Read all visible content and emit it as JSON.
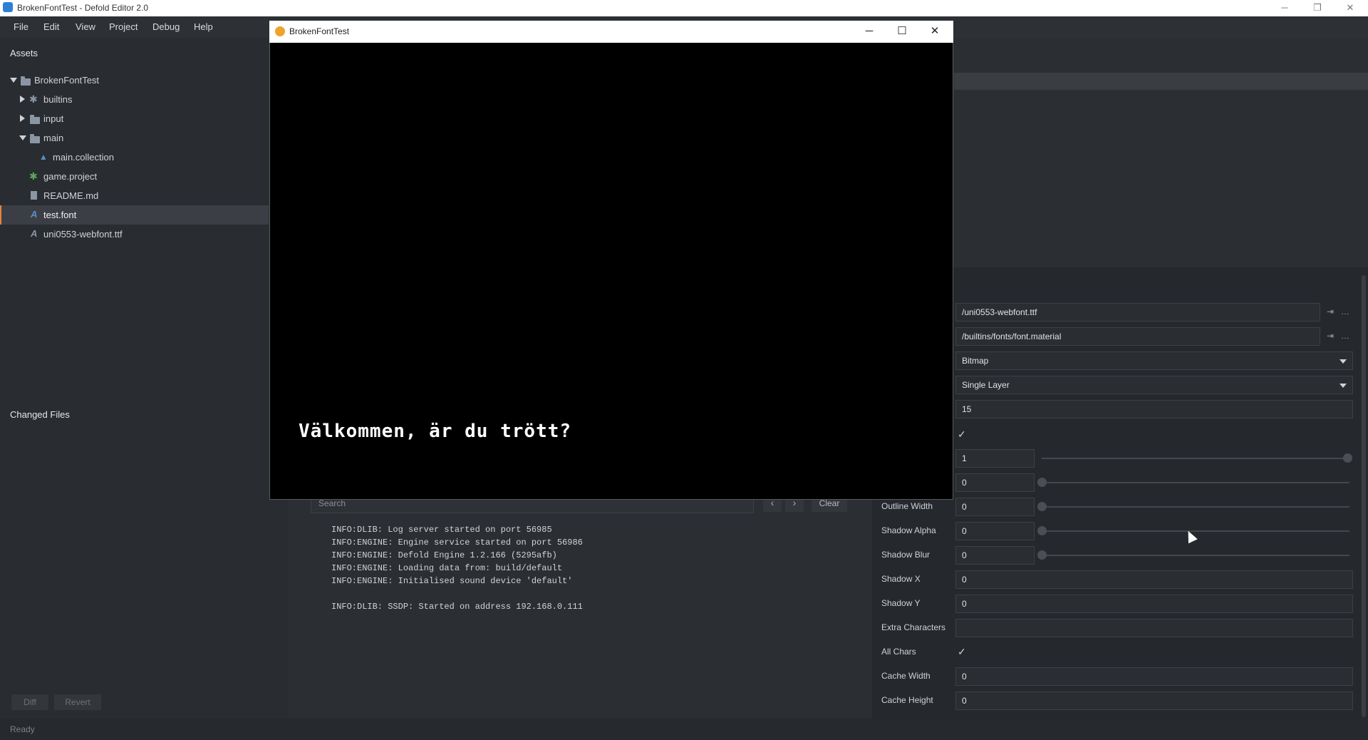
{
  "window": {
    "title": "BrokenFontTest - Defold Editor 2.0",
    "min": "─",
    "restore": "❐",
    "close": "✕"
  },
  "menubar": [
    "File",
    "Edit",
    "View",
    "Project",
    "Debug",
    "Help"
  ],
  "assets": {
    "header": "Assets",
    "tree": [
      {
        "label": "BrokenFontTest",
        "icon": "folder-icon"
      },
      {
        "label": "builtins",
        "icon": "gear-icon"
      },
      {
        "label": "input",
        "icon": "folder-icon"
      },
      {
        "label": "main",
        "icon": "folder-icon"
      },
      {
        "label": "main.collection",
        "icon": "collection-icon"
      },
      {
        "label": "game.project",
        "icon": "gear-icon"
      },
      {
        "label": "README.md",
        "icon": "file-icon"
      },
      {
        "label": "test.font",
        "icon": "font-icon"
      },
      {
        "label": "uni0553-webfont.ttf",
        "icon": "font-icon"
      }
    ]
  },
  "changed_files": {
    "header": "Changed Files",
    "diff": "Diff",
    "revert": "Revert"
  },
  "status": "Ready",
  "console": {
    "search_placeholder": "Search",
    "prev": "‹",
    "next": "›",
    "clear": "Clear",
    "lines": [
      "INFO:DLIB: Log server started on port 56985",
      "INFO:ENGINE: Engine service started on port 56986",
      "INFO:ENGINE: Defold Engine 1.2.166 (5295afb)",
      "INFO:ENGINE: Loading data from: build/default",
      "INFO:ENGINE: Initialised sound device 'default'",
      "",
      "INFO:DLIB: SSDP: Started on address 192.168.0.111"
    ]
  },
  "properties": {
    "font_path": "/uni0553-webfont.ttf",
    "material_path": "/builtins/fonts/font.material",
    "output_format": "Bitmap",
    "render_mode": "Single Layer",
    "size": "15",
    "alpha": "1",
    "outline_alpha": "0",
    "outline_width_label": "Outline Width",
    "outline_width": "0",
    "shadow_alpha_label": "Shadow Alpha",
    "shadow_alpha": "0",
    "shadow_blur_label": "Shadow Blur",
    "shadow_blur": "0",
    "shadow_x_label": "Shadow X",
    "shadow_x": "0",
    "shadow_y_label": "Shadow Y",
    "shadow_y": "0",
    "extra_characters_label": "Extra Characters",
    "extra_characters": "",
    "all_chars_label": "All Chars",
    "cache_width_label": "Cache Width",
    "cache_width": "0",
    "cache_height_label": "Cache Height",
    "cache_height": "0"
  },
  "game_window": {
    "title": "BrokenFontTest",
    "min": "─",
    "max": "☐",
    "close": "✕",
    "text": "Välkommen, är du trött?"
  },
  "colors": {
    "accent": "#e8823a",
    "background": "#2b2e33"
  }
}
